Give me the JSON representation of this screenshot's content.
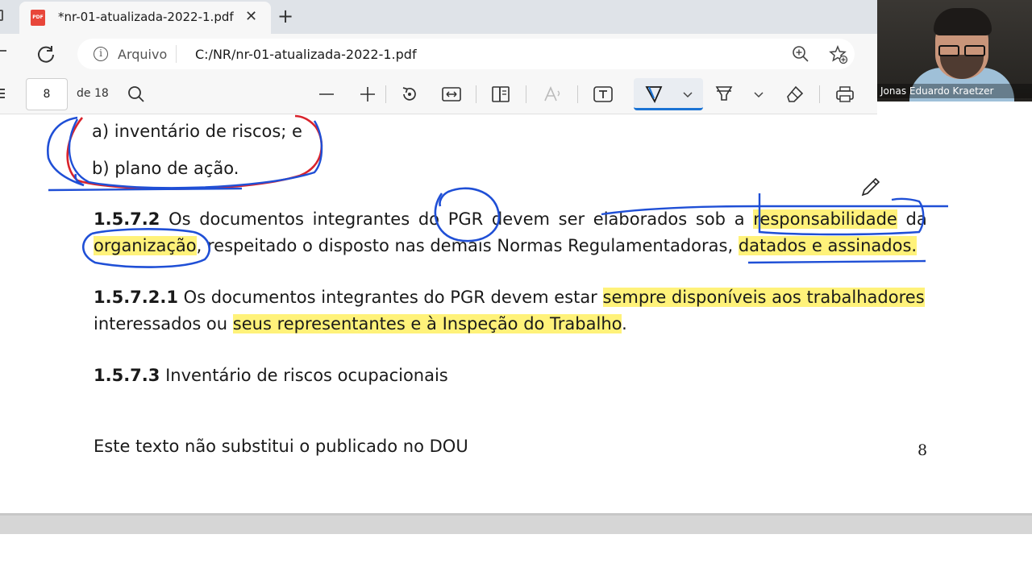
{
  "browser": {
    "tab_title": "*nr-01-atualizada-2022-1.pdf",
    "tab_favicon_text": "PDF",
    "close_glyph": "✕",
    "new_tab_glyph": "+",
    "origin_label": "Arquivo",
    "url": "C:/NR/nr-01-atualizada-2022-1.pdf"
  },
  "pdf_toolbar": {
    "page_number": "8",
    "page_total": "de 18"
  },
  "webcam": {
    "name": "Jonas Eduardo Kraetzer"
  },
  "document": {
    "item_a": "a)  inventário de riscos; e",
    "item_b": "b)  plano de ação.",
    "p1_num": "1.5.7.2",
    "p1_line1_plain": " Os documentos integrantes do PGR devem ser elaborados sob a ",
    "p1_line1_hl": "responsabilidade",
    "p1_line1_end": " da",
    "p1_line2_hl1": "organização",
    "p1_line2_mid": ", respeitado o disposto nas demais Normas Regulamentadoras, ",
    "p1_line2_hl2": "datados e assinados.",
    "p2_num": "1.5.7.2.1",
    "p2_line1_plain": " Os documentos integrantes do PGR devem estar ",
    "p2_line1_hl": "sempre disponíveis aos trabalhadores",
    "p2_line2_plain": "interessados ou ",
    "p2_line2_hl": "seus representantes e à Inspeção do Trabalho",
    "p2_line2_end": ".",
    "p3_num": "1.5.7.3",
    "p3_text": " Inventário de riscos ocupacionais",
    "footer_text": "Este texto não substitui o publicado no DOU",
    "footer_page": "8"
  },
  "colors": {
    "highlight": "#fff27a",
    "ink_blue": "#1f4fd6",
    "ink_red": "#d9232c",
    "active_tool_underline": "#1a73d4"
  }
}
